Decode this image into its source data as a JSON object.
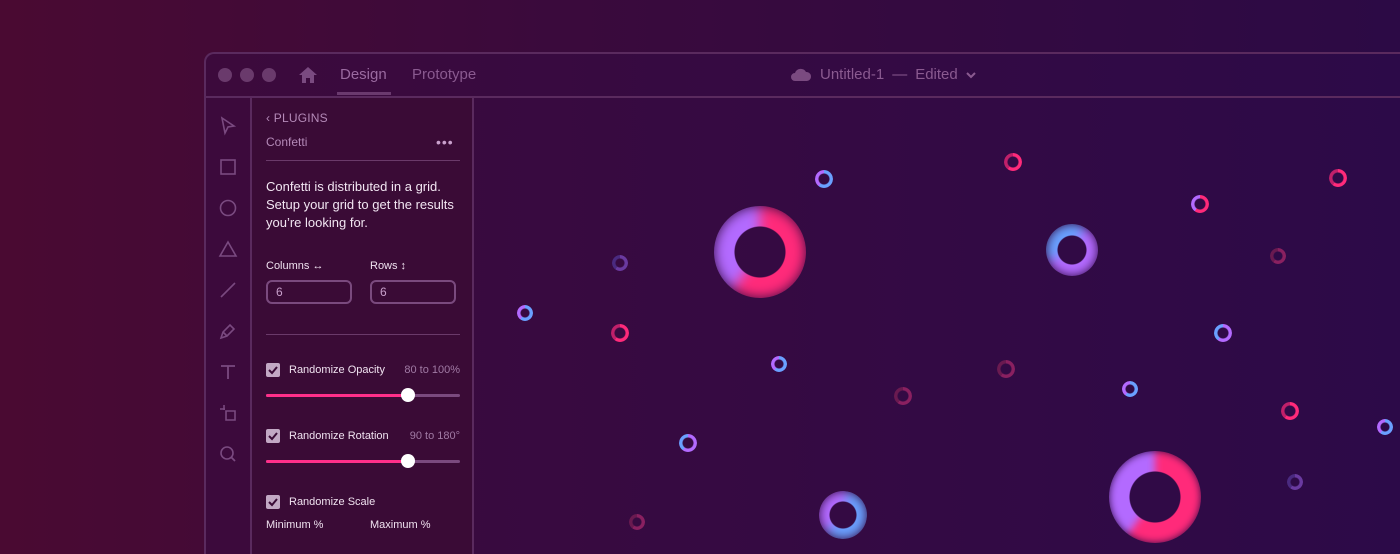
{
  "window": {
    "tabs": [
      {
        "label": "Design",
        "active": true
      },
      {
        "label": "Prototype",
        "active": false
      }
    ],
    "document_title": "Untitled-1",
    "separator": "—",
    "document_status": "Edited"
  },
  "toolbar": {
    "tools": [
      "select-icon",
      "rectangle-icon",
      "ellipse-icon",
      "triangle-icon",
      "line-icon",
      "pen-icon",
      "text-icon",
      "artboard-icon",
      "zoom-icon"
    ]
  },
  "panel": {
    "back_label": "PLUGINS",
    "plugin_name": "Confetti",
    "description": "Confetti is distributed in a grid. Setup your grid to get the results you’re looking for.",
    "columns": {
      "label": "Columns ↔",
      "value": "6"
    },
    "rows": {
      "label": "Rows ↕",
      "value": "6"
    },
    "opacity": {
      "label": "Randomize Opacity",
      "range": "80 to 100%",
      "checked": true,
      "slider_fraction": 0.73
    },
    "rotation": {
      "label": "Randomize Rotation",
      "range": "90 to 180°",
      "checked": true,
      "slider_fraction": 0.73
    },
    "scale": {
      "label": "Randomize Scale",
      "checked": true,
      "min_label": "Minimum %",
      "max_label": "Maximum %"
    }
  },
  "colors": {
    "accent": "#ff2f8a",
    "confetti_pink": "#ff2a7a",
    "confetti_purple": "#b36aff",
    "confetti_blue": "#6aa0ff"
  }
}
